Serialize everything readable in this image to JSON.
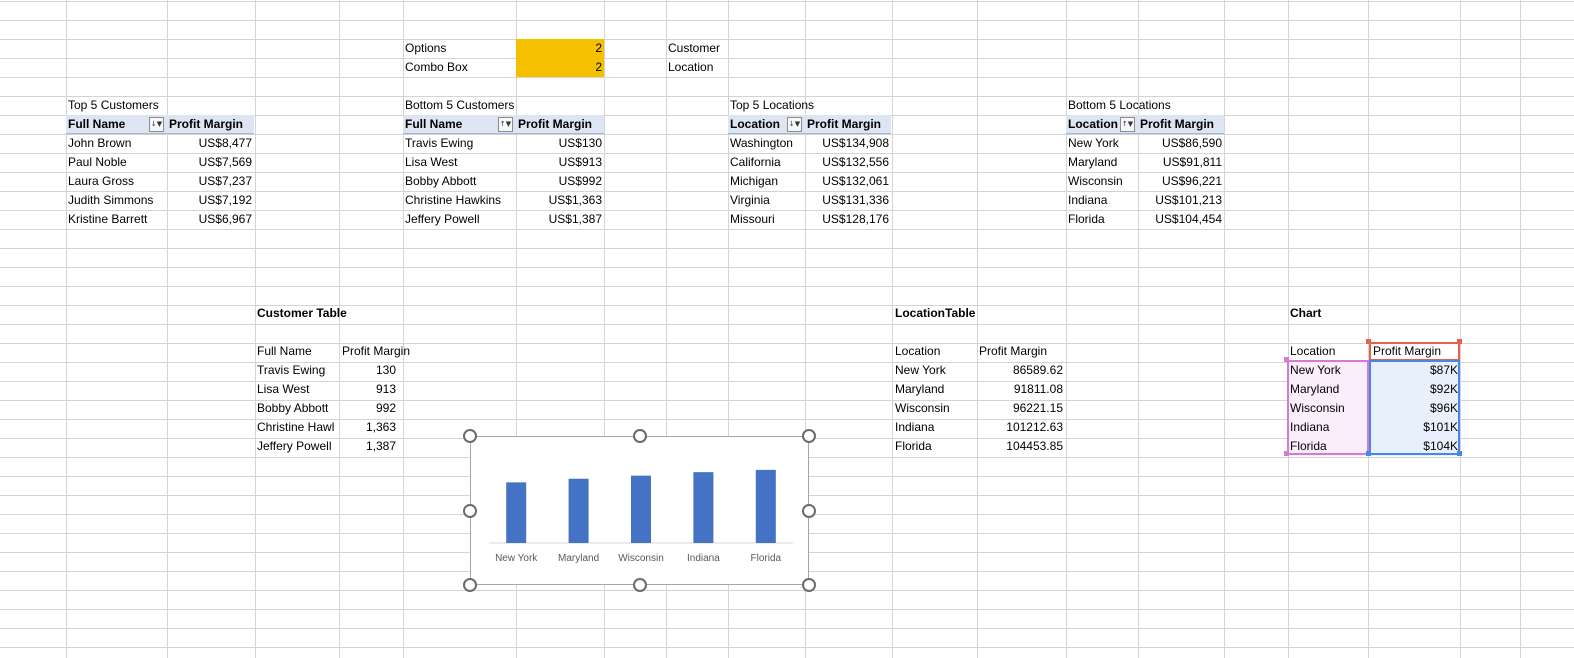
{
  "controls": {
    "options_label": "Options",
    "options_value": "2",
    "combo_label": "Combo Box",
    "combo_value": "2",
    "customer_label": "Customer",
    "location_label": "Location"
  },
  "top5_customers": {
    "title": "Top 5 Customers",
    "headers": [
      "Full Name",
      "Profit Margin"
    ],
    "rows": [
      [
        "John Brown",
        "US$8,477"
      ],
      [
        "Paul Noble",
        "US$7,569"
      ],
      [
        "Laura Gross",
        "US$7,237"
      ],
      [
        "Judith Simmons",
        "US$7,192"
      ],
      [
        "Kristine Barrett",
        "US$6,967"
      ]
    ]
  },
  "bottom5_customers": {
    "title": "Bottom 5 Customers",
    "headers": [
      "Full Name",
      "Profit Margin"
    ],
    "rows": [
      [
        "Travis Ewing",
        "US$130"
      ],
      [
        "Lisa West",
        "US$913"
      ],
      [
        "Bobby Abbott",
        "US$992"
      ],
      [
        "Christine Hawkins",
        "US$1,363"
      ],
      [
        "Jeffery Powell",
        "US$1,387"
      ]
    ]
  },
  "top5_locations": {
    "title": "Top 5 Locations",
    "headers": [
      "Location",
      "Profit Margin"
    ],
    "rows": [
      [
        "Washington",
        "US$134,908"
      ],
      [
        "California",
        "US$132,556"
      ],
      [
        "Michigan",
        "US$132,061"
      ],
      [
        "Virginia",
        "US$131,336"
      ],
      [
        "Missouri",
        "US$128,176"
      ]
    ]
  },
  "bottom5_locations": {
    "title": "Bottom 5 Locations",
    "headers": [
      "Location",
      "Profit Margin"
    ],
    "rows": [
      [
        "New York",
        "US$86,590"
      ],
      [
        "Maryland",
        "US$91,811"
      ],
      [
        "Wisconsin",
        "US$96,221"
      ],
      [
        "Indiana",
        "US$101,213"
      ],
      [
        "Florida",
        "US$104,454"
      ]
    ]
  },
  "customer_table": {
    "title": "Customer Table",
    "headers": [
      "Full Name",
      "Profit Margin"
    ],
    "rows": [
      [
        "Travis Ewing",
        "130"
      ],
      [
        "Lisa West",
        "913"
      ],
      [
        "Bobby Abbott",
        "992"
      ],
      [
        "Christine Hawl",
        "1,363"
      ],
      [
        "Jeffery Powell",
        "1,387"
      ]
    ]
  },
  "location_table": {
    "title": "LocationTable",
    "headers": [
      "Location",
      "Profit Margin"
    ],
    "rows": [
      [
        "New York",
        "86589.62"
      ],
      [
        "Maryland",
        "91811.08"
      ],
      [
        "Wisconsin",
        "96221.15"
      ],
      [
        "Indiana",
        "101212.63"
      ],
      [
        "Florida",
        "104453.85"
      ]
    ]
  },
  "chart_table": {
    "title": "Chart",
    "headers": [
      "Location",
      "Profit Margin"
    ],
    "rows": [
      [
        "New York",
        "$87K"
      ],
      [
        "Maryland",
        "$92K"
      ],
      [
        "Wisconsin",
        "$96K"
      ],
      [
        "Indiana",
        "$101K"
      ],
      [
        "Florida",
        "$104K"
      ]
    ]
  },
  "chart_data": {
    "type": "bar",
    "categories": [
      "New York",
      "Maryland",
      "Wisconsin",
      "Indiana",
      "Florida"
    ],
    "values": [
      86589.62,
      91811.08,
      96221.15,
      101212.63,
      104453.85
    ],
    "title": "",
    "xlabel": "",
    "ylabel": "",
    "ylim": [
      0,
      140000
    ],
    "grid": false,
    "bar_color": "#4472c4"
  },
  "colors": {
    "header_fill": "#dde5f3",
    "control_fill": "#f5c000",
    "grid": "#d4d4d4"
  }
}
